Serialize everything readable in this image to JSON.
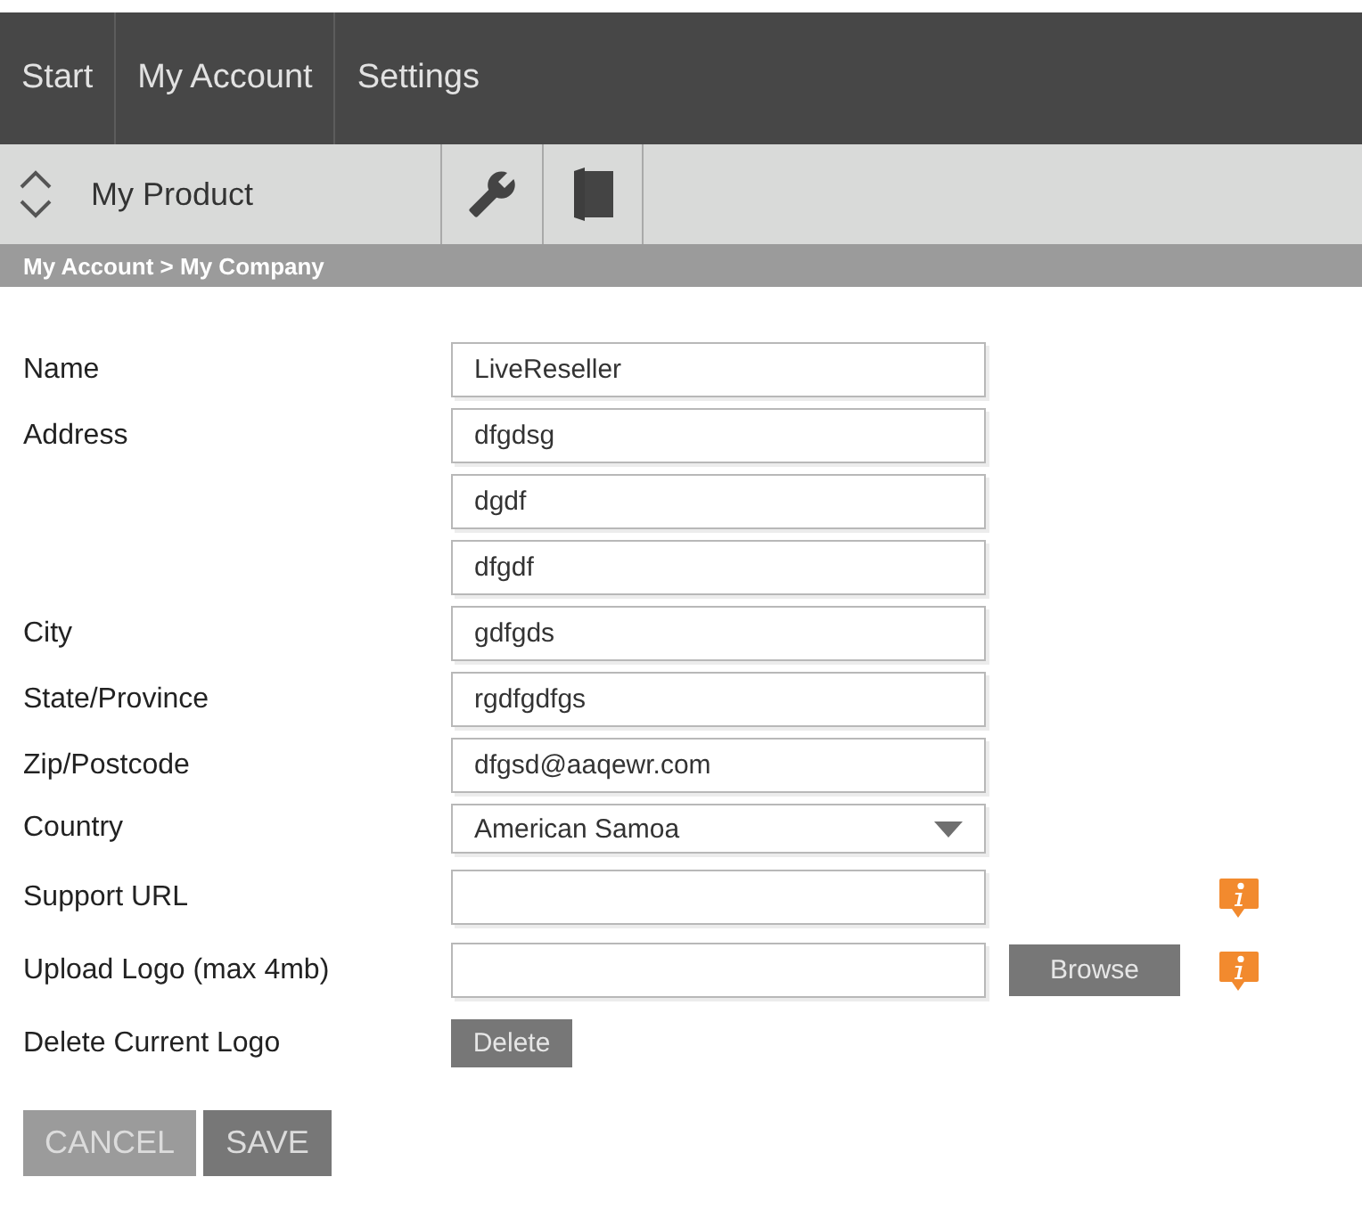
{
  "nav": {
    "items": [
      {
        "label": "Start"
      },
      {
        "label": "My Account"
      },
      {
        "label": "Settings"
      }
    ]
  },
  "product_bar": {
    "title": "My Product"
  },
  "breadcrumb": "My Account > My Company",
  "form": {
    "rows": [
      {
        "kind": "text",
        "label": "Name",
        "value": "LiveReseller"
      },
      {
        "kind": "text",
        "label": "Address",
        "value": "dfgdsg"
      },
      {
        "kind": "text",
        "value": "dgdf"
      },
      {
        "kind": "text",
        "value": "dfgdf"
      },
      {
        "kind": "text",
        "label": "City",
        "value": "gdfgds"
      },
      {
        "kind": "text",
        "label": "State/Province",
        "value": "rgdfgdfgs"
      },
      {
        "kind": "text",
        "label": "Zip/Postcode",
        "value": "dfgsd@aaqewr.com"
      },
      {
        "kind": "select",
        "label": "Country",
        "value": "American Samoa"
      },
      {
        "kind": "text",
        "label": "Support URL",
        "info": true
      },
      {
        "kind": "file",
        "label": "Upload Logo (max 4mb)",
        "button": "Browse",
        "info": true
      },
      {
        "kind": "button",
        "label": "Delete Current Logo",
        "button": "Delete"
      }
    ]
  },
  "actions": [
    {
      "kind": "cancel",
      "label": "CANCEL"
    },
    {
      "kind": "save",
      "label": "SAVE"
    }
  ]
}
